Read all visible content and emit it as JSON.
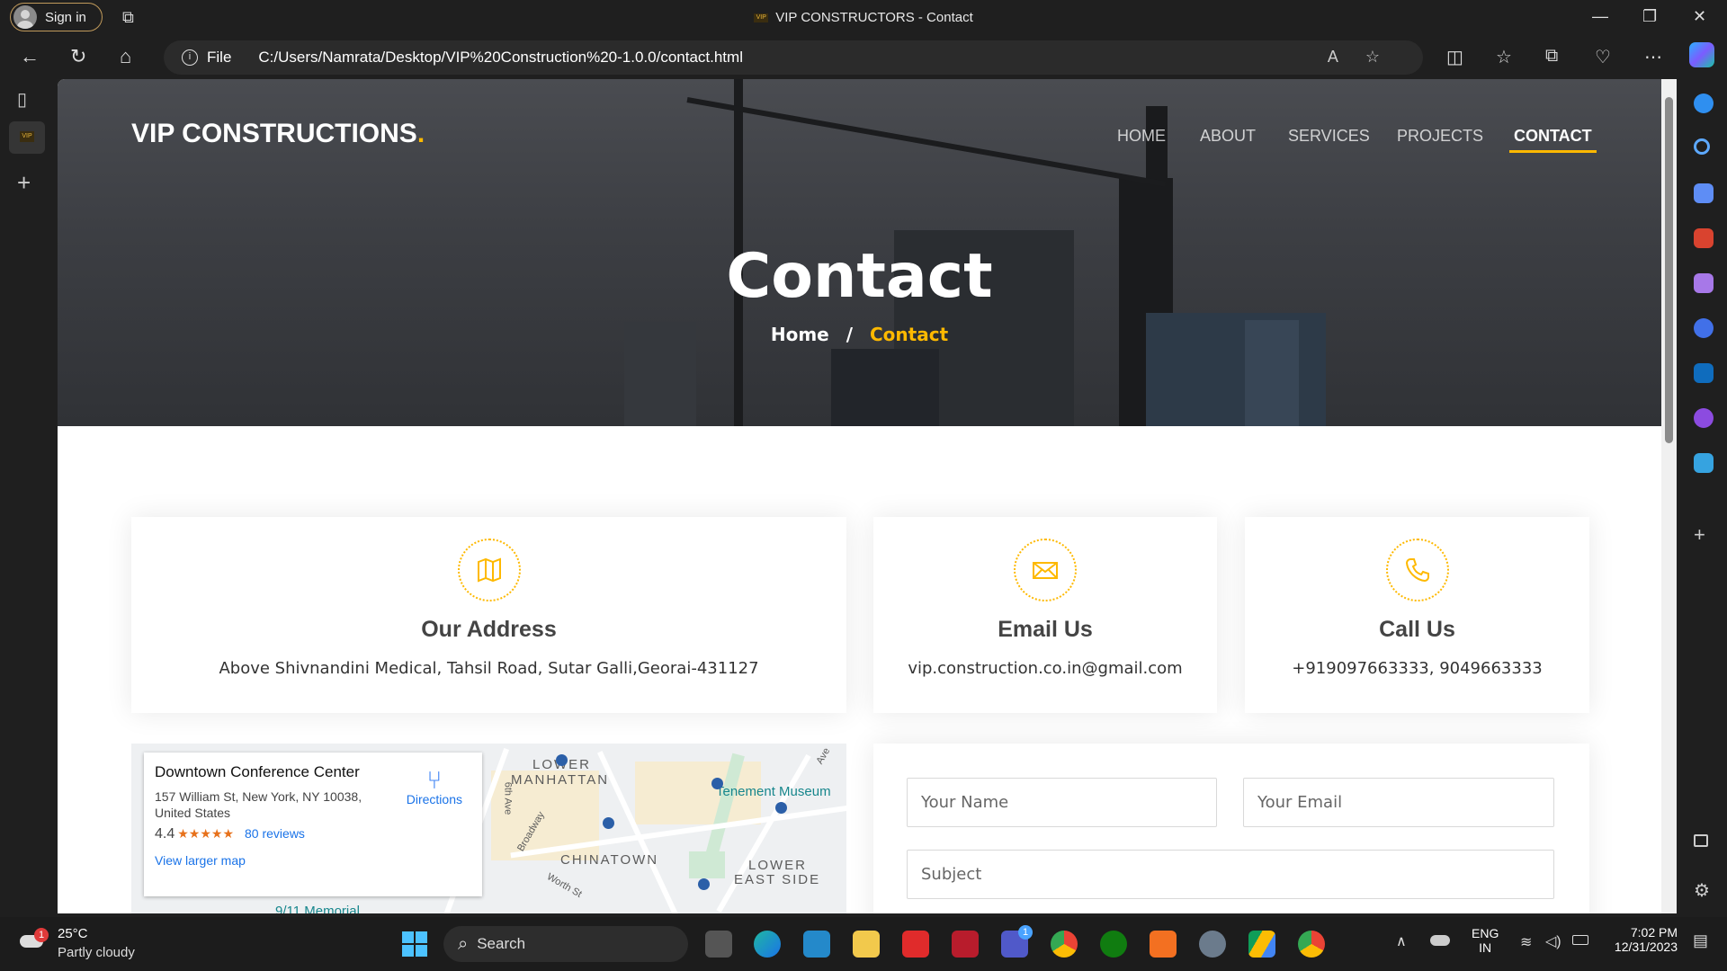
{
  "browser": {
    "signin_label": "Sign in",
    "tab_title": "VIP CONSTRUCTORS - Contact",
    "url_scheme_label": "File",
    "url": "C:/Users/Namrata/Desktop/VIP%20Construction%20-1.0.0/contact.html",
    "favicon_text": "VIP"
  },
  "site": {
    "logo_text": "VIP CONSTRUCTIONS",
    "logo_dot": ".",
    "nav": [
      "HOME",
      "ABOUT",
      "SERVICES",
      "PROJECTS",
      "CONTACT"
    ],
    "active_nav": "CONTACT",
    "page_title": "Contact",
    "breadcrumb_home": "Home",
    "breadcrumb_sep": "/",
    "breadcrumb_current": "Contact",
    "accent_color": "#feb900"
  },
  "cards": [
    {
      "icon": "map-icon",
      "title": "Our Address",
      "text": "Above Shivnandini Medical, Tahsil Road, Sutar Galli,Georai-431127"
    },
    {
      "icon": "envelope-icon",
      "title": "Email Us",
      "text": "vip.construction.co.in@gmail.com"
    },
    {
      "icon": "phone-icon",
      "title": "Call Us",
      "text": "+919097663333, 9049663333"
    }
  ],
  "map": {
    "place_name": "Downtown Conference Center",
    "address": "157 William St, New York, NY 10038, United States",
    "rating": "4.4",
    "stars": "★★★★★",
    "reviews": "80 reviews",
    "view_larger": "View larger map",
    "directions": "Directions",
    "labels": [
      "LOWER",
      "MANHATTAN",
      "CHINATOWN",
      "LOWER",
      "EAST SIDE",
      "Tenement Museum",
      "9/11 Memorial",
      "Broadway",
      "Worth St",
      "6th Ave",
      "Ave"
    ]
  },
  "form": {
    "name_placeholder": "Your Name",
    "email_placeholder": "Your Email",
    "subject_placeholder": "Subject"
  },
  "taskbar": {
    "weather_temp": "25°C",
    "weather_text": "Partly cloudy",
    "search_label": "Search",
    "lang_top": "ENG",
    "lang_bottom": "IN",
    "time": "7:02 PM",
    "date": "12/31/2023",
    "weather_badge": "1",
    "teams_badge": "1"
  }
}
